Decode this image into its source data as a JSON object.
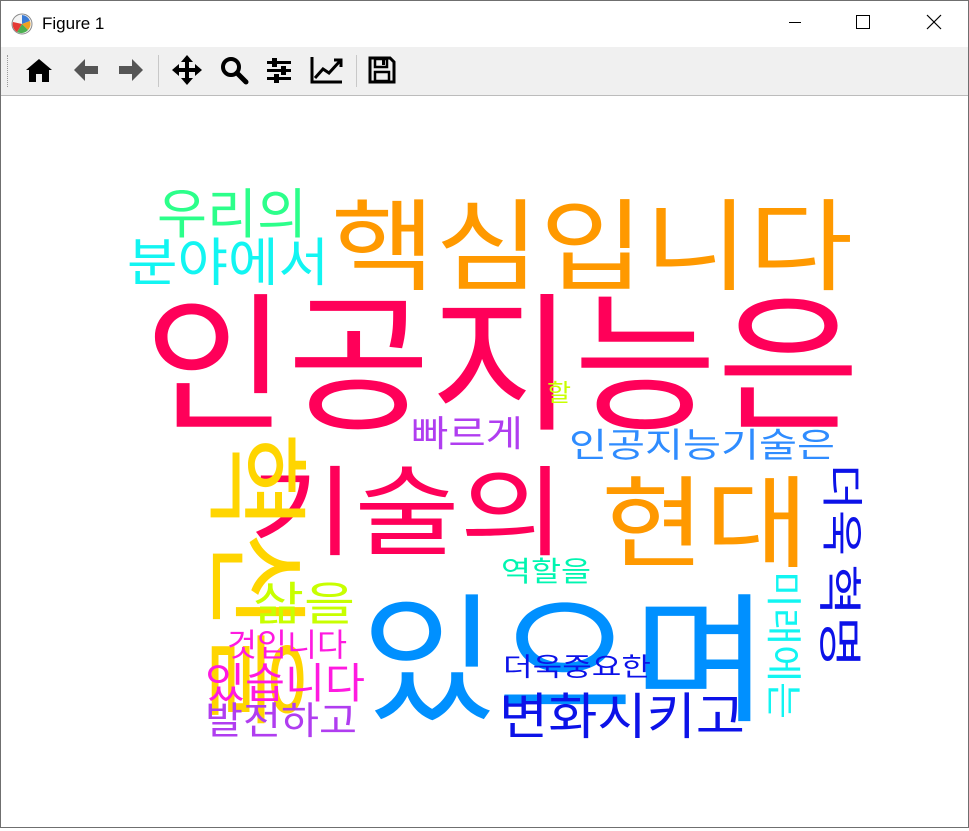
{
  "window": {
    "title": "Figure 1",
    "app_icon": "matplotlib-icon",
    "controls": {
      "minimize_icon": "minimize-icon",
      "maximize_icon": "maximize-icon",
      "close_icon": "close-icon"
    }
  },
  "toolbar": {
    "buttons": [
      {
        "name": "home-button",
        "icon": "home-icon"
      },
      {
        "name": "back-button",
        "icon": "arrow-left-icon"
      },
      {
        "name": "forward-button",
        "icon": "arrow-right-icon"
      },
      {
        "name": "pan-button",
        "icon": "move-icon"
      },
      {
        "name": "zoom-button",
        "icon": "magnifier-icon"
      },
      {
        "name": "configure-subplots-button",
        "icon": "sliders-icon"
      },
      {
        "name": "edit-axis-button",
        "icon": "line-chart-icon"
      },
      {
        "name": "save-button",
        "icon": "floppy-disk-icon"
      }
    ]
  },
  "wordcloud": {
    "colors": {
      "crimson": "#ff0059",
      "orange": "#ff9900",
      "blue": "#0090ff",
      "gold": "#ffd500",
      "navy": "#0c12e8",
      "purple": "#b03df0",
      "magenta": "#ff1ae0",
      "cyan": "#12f5f2",
      "teal": "#00f5b0",
      "sky": "#2f8cff",
      "lime": "#c8ff00",
      "spring": "#2cff8a"
    },
    "words": [
      {
        "text": "인공지능은"
      },
      {
        "text": "핵심입니다"
      },
      {
        "text": "우리의"
      },
      {
        "text": "분야에서"
      },
      {
        "text": "기술의"
      },
      {
        "text": "현대"
      },
      {
        "text": "있으며"
      },
      {
        "text": "혁신을"
      },
      {
        "text": "빠르게"
      },
      {
        "text": "할"
      },
      {
        "text": "인공지능기술은"
      },
      {
        "text": "더욱"
      },
      {
        "text": "역할을"
      },
      {
        "text": "삶을"
      },
      {
        "text": "것입니다"
      },
      {
        "text": "있습니다"
      },
      {
        "text": "발전하고"
      },
      {
        "text": "더욱중요한"
      },
      {
        "text": "변화시키고"
      },
      {
        "text": "미래에는"
      },
      {
        "text": "혁명"
      }
    ]
  }
}
